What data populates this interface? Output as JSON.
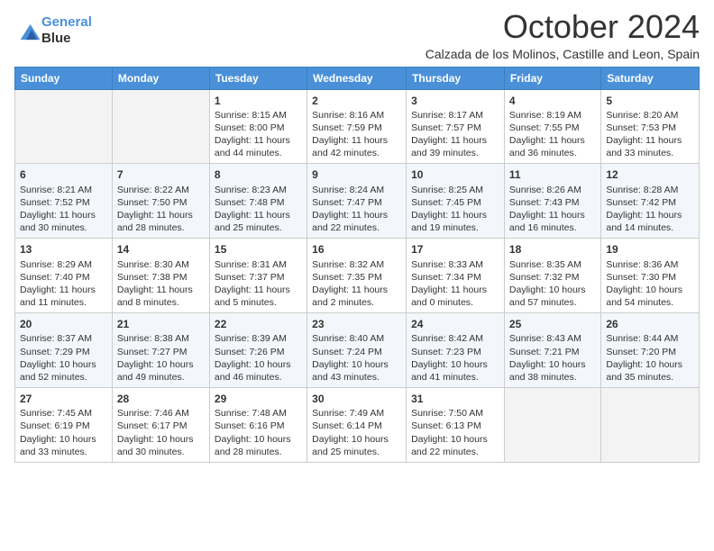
{
  "logo": {
    "line1": "General",
    "line2": "Blue"
  },
  "title": "October 2024",
  "location": "Calzada de los Molinos, Castille and Leon, Spain",
  "headers": [
    "Sunday",
    "Monday",
    "Tuesday",
    "Wednesday",
    "Thursday",
    "Friday",
    "Saturday"
  ],
  "weeks": [
    [
      {
        "day": "",
        "info": ""
      },
      {
        "day": "",
        "info": ""
      },
      {
        "day": "1",
        "info": "Sunrise: 8:15 AM\nSunset: 8:00 PM\nDaylight: 11 hours and 44 minutes."
      },
      {
        "day": "2",
        "info": "Sunrise: 8:16 AM\nSunset: 7:59 PM\nDaylight: 11 hours and 42 minutes."
      },
      {
        "day": "3",
        "info": "Sunrise: 8:17 AM\nSunset: 7:57 PM\nDaylight: 11 hours and 39 minutes."
      },
      {
        "day": "4",
        "info": "Sunrise: 8:19 AM\nSunset: 7:55 PM\nDaylight: 11 hours and 36 minutes."
      },
      {
        "day": "5",
        "info": "Sunrise: 8:20 AM\nSunset: 7:53 PM\nDaylight: 11 hours and 33 minutes."
      }
    ],
    [
      {
        "day": "6",
        "info": "Sunrise: 8:21 AM\nSunset: 7:52 PM\nDaylight: 11 hours and 30 minutes."
      },
      {
        "day": "7",
        "info": "Sunrise: 8:22 AM\nSunset: 7:50 PM\nDaylight: 11 hours and 28 minutes."
      },
      {
        "day": "8",
        "info": "Sunrise: 8:23 AM\nSunset: 7:48 PM\nDaylight: 11 hours and 25 minutes."
      },
      {
        "day": "9",
        "info": "Sunrise: 8:24 AM\nSunset: 7:47 PM\nDaylight: 11 hours and 22 minutes."
      },
      {
        "day": "10",
        "info": "Sunrise: 8:25 AM\nSunset: 7:45 PM\nDaylight: 11 hours and 19 minutes."
      },
      {
        "day": "11",
        "info": "Sunrise: 8:26 AM\nSunset: 7:43 PM\nDaylight: 11 hours and 16 minutes."
      },
      {
        "day": "12",
        "info": "Sunrise: 8:28 AM\nSunset: 7:42 PM\nDaylight: 11 hours and 14 minutes."
      }
    ],
    [
      {
        "day": "13",
        "info": "Sunrise: 8:29 AM\nSunset: 7:40 PM\nDaylight: 11 hours and 11 minutes."
      },
      {
        "day": "14",
        "info": "Sunrise: 8:30 AM\nSunset: 7:38 PM\nDaylight: 11 hours and 8 minutes."
      },
      {
        "day": "15",
        "info": "Sunrise: 8:31 AM\nSunset: 7:37 PM\nDaylight: 11 hours and 5 minutes."
      },
      {
        "day": "16",
        "info": "Sunrise: 8:32 AM\nSunset: 7:35 PM\nDaylight: 11 hours and 2 minutes."
      },
      {
        "day": "17",
        "info": "Sunrise: 8:33 AM\nSunset: 7:34 PM\nDaylight: 11 hours and 0 minutes."
      },
      {
        "day": "18",
        "info": "Sunrise: 8:35 AM\nSunset: 7:32 PM\nDaylight: 10 hours and 57 minutes."
      },
      {
        "day": "19",
        "info": "Sunrise: 8:36 AM\nSunset: 7:30 PM\nDaylight: 10 hours and 54 minutes."
      }
    ],
    [
      {
        "day": "20",
        "info": "Sunrise: 8:37 AM\nSunset: 7:29 PM\nDaylight: 10 hours and 52 minutes."
      },
      {
        "day": "21",
        "info": "Sunrise: 8:38 AM\nSunset: 7:27 PM\nDaylight: 10 hours and 49 minutes."
      },
      {
        "day": "22",
        "info": "Sunrise: 8:39 AM\nSunset: 7:26 PM\nDaylight: 10 hours and 46 minutes."
      },
      {
        "day": "23",
        "info": "Sunrise: 8:40 AM\nSunset: 7:24 PM\nDaylight: 10 hours and 43 minutes."
      },
      {
        "day": "24",
        "info": "Sunrise: 8:42 AM\nSunset: 7:23 PM\nDaylight: 10 hours and 41 minutes."
      },
      {
        "day": "25",
        "info": "Sunrise: 8:43 AM\nSunset: 7:21 PM\nDaylight: 10 hours and 38 minutes."
      },
      {
        "day": "26",
        "info": "Sunrise: 8:44 AM\nSunset: 7:20 PM\nDaylight: 10 hours and 35 minutes."
      }
    ],
    [
      {
        "day": "27",
        "info": "Sunrise: 7:45 AM\nSunset: 6:19 PM\nDaylight: 10 hours and 33 minutes."
      },
      {
        "day": "28",
        "info": "Sunrise: 7:46 AM\nSunset: 6:17 PM\nDaylight: 10 hours and 30 minutes."
      },
      {
        "day": "29",
        "info": "Sunrise: 7:48 AM\nSunset: 6:16 PM\nDaylight: 10 hours and 28 minutes."
      },
      {
        "day": "30",
        "info": "Sunrise: 7:49 AM\nSunset: 6:14 PM\nDaylight: 10 hours and 25 minutes."
      },
      {
        "day": "31",
        "info": "Sunrise: 7:50 AM\nSunset: 6:13 PM\nDaylight: 10 hours and 22 minutes."
      },
      {
        "day": "",
        "info": ""
      },
      {
        "day": "",
        "info": ""
      }
    ]
  ]
}
